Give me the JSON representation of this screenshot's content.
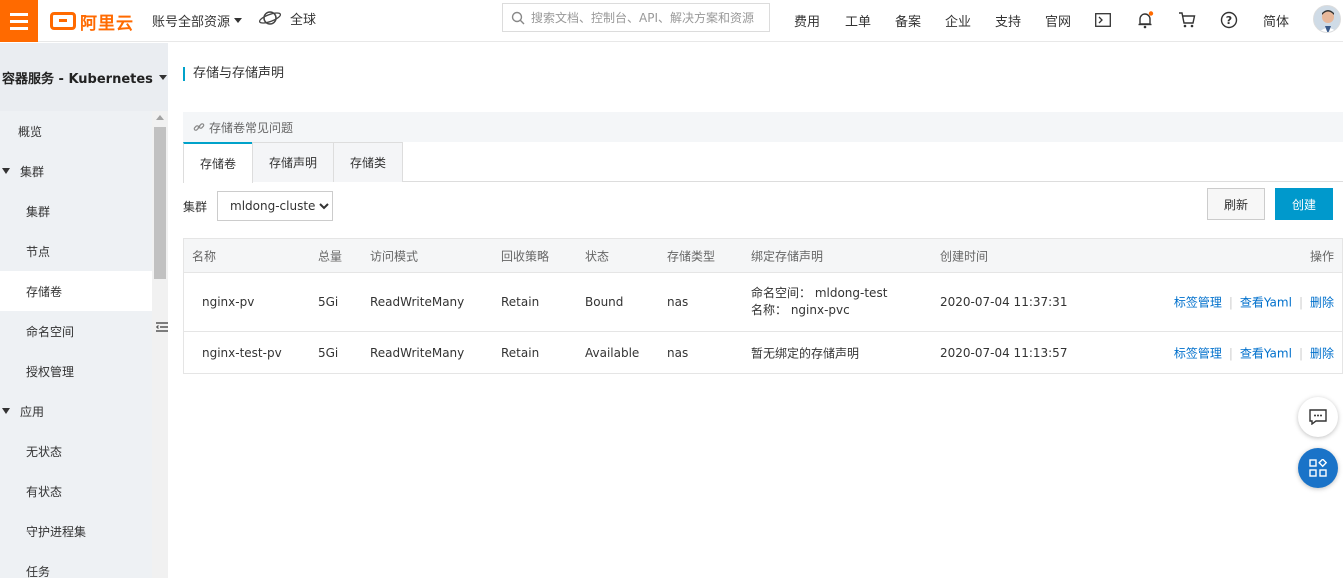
{
  "topbar": {
    "logo_text": "阿里云",
    "account_scope": "账号全部资源",
    "region": "全球",
    "search_placeholder": "搜索文档、控制台、API、解决方案和资源",
    "nav": [
      "费用",
      "工单",
      "备案",
      "企业",
      "支持",
      "官网"
    ],
    "language": "简体",
    "notification_dot_color": "#ff6a00"
  },
  "sidebar": {
    "title": "容器服务 - Kubernetes",
    "items": [
      {
        "label": "概览",
        "level": 1
      },
      {
        "label": "集群",
        "level": 0,
        "group": true
      },
      {
        "label": "集群",
        "level": 2
      },
      {
        "label": "节点",
        "level": 2
      },
      {
        "label": "存储卷",
        "level": 2,
        "active": true
      },
      {
        "label": "命名空间",
        "level": 2
      },
      {
        "label": "授权管理",
        "level": 2
      },
      {
        "label": "应用",
        "level": 0,
        "group": true
      },
      {
        "label": "无状态",
        "level": 2
      },
      {
        "label": "有状态",
        "level": 2
      },
      {
        "label": "守护进程集",
        "level": 2
      },
      {
        "label": "任务",
        "level": 2
      }
    ]
  },
  "main": {
    "page_title": "存储与存储声明",
    "faq_link": "存储卷常见问题",
    "tabs": [
      "存储卷",
      "存储声明",
      "存储类"
    ],
    "active_tab": 0,
    "cluster_label": "集群",
    "cluster_value": "mldong-cluster",
    "refresh_label": "刷新",
    "create_label": "创建",
    "table": {
      "headers": [
        "名称",
        "总量",
        "访问模式",
        "回收策略",
        "状态",
        "存储类型",
        "绑定存储声明",
        "创建时间",
        "操作"
      ],
      "rows": [
        {
          "name": "nginx-pv",
          "capacity": "5Gi",
          "access_mode": "ReadWriteMany",
          "reclaim": "Retain",
          "status": "Bound",
          "type": "nas",
          "pvc_line1": "命名空间： mldong-test",
          "pvc_line2": "名称： nginx-pvc",
          "created": "2020-07-04 11:37:31"
        },
        {
          "name": "nginx-test-pv",
          "capacity": "5Gi",
          "access_mode": "ReadWriteMany",
          "reclaim": "Retain",
          "status": "Available",
          "type": "nas",
          "pvc_line1": "暂无绑定的存储声明",
          "pvc_line2": "",
          "created": "2020-07-04 11:13:57"
        }
      ],
      "actions": [
        "标签管理",
        "查看Yaml",
        "删除"
      ],
      "action_separator": "|"
    }
  },
  "colors": {
    "brand": "#ff6a00",
    "primary": "#0099cc",
    "link": "#0070cc",
    "float_primary": "#1a73c8"
  }
}
